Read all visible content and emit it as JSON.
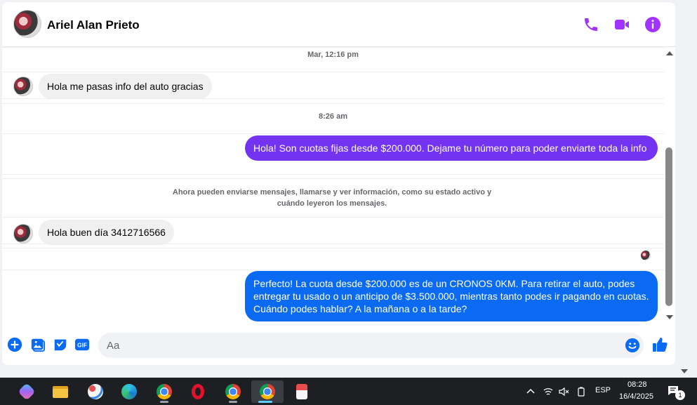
{
  "header": {
    "contact_name": "Ariel Alan Prieto",
    "icons": [
      "phone-icon",
      "video-icon",
      "info-icon"
    ],
    "accent_color": "#a033ff"
  },
  "messages": {
    "timestamp_1": "Mar, 12:16 pm",
    "incoming_1": "Hola me pasas info del auto gracias",
    "timestamp_2": "8:26 am",
    "outgoing_1": "Hola! Son cuotas fijas desde $200.000. Dejame tu número para poder enviarte toda la info",
    "system_notice": "Ahora pueden enviarse mensajes, llamarse y ver información, como su estado activo y cuándo leyeron los mensajes.",
    "incoming_2": "Hola buen día 3412716566",
    "outgoing_2": "Perfecto! La cuota desde $200.000 es de un CRONOS 0KM. Para retirar el auto, podes entregar tu usado o un anticipo de $3.500.000, mientras tanto podes ir pagando en cuotas. Cuándo podes hablar? A la mañana o a la tarde?",
    "outgoing_1_color": "#7433f0",
    "outgoing_2_color": "#0a6af2"
  },
  "composer": {
    "placeholder": "Aa",
    "gif_label": "GIF",
    "icons": [
      "plus-icon",
      "image-icon",
      "sticker-icon",
      "gif-icon",
      "emoji-icon",
      "like-icon"
    ]
  },
  "taskbar": {
    "apps": [
      "copilot-icon",
      "file-explorer-icon",
      "paint-icon",
      "edge-icon",
      "chrome-icon",
      "opera-icon",
      "chrome-profile-icon",
      "chrome-profile-2-icon",
      "snipping-tool-icon"
    ],
    "language": "ESP",
    "time": "08:28",
    "date": "16/4/2025",
    "notification_count": "1"
  }
}
